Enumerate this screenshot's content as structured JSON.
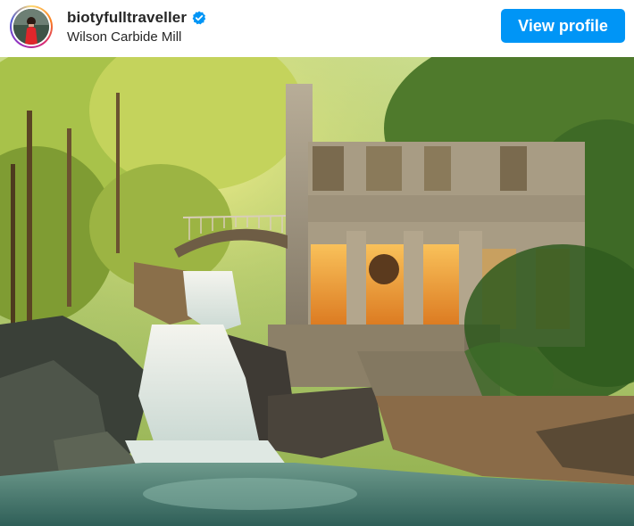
{
  "header": {
    "username": "biotyfulltraveller",
    "verified_icon": "verified-badge-icon",
    "location": "Wilson Carbide Mill",
    "view_profile_label": "View profile",
    "button_color": "#0095f6"
  },
  "photo": {
    "icon": "post-photo"
  }
}
